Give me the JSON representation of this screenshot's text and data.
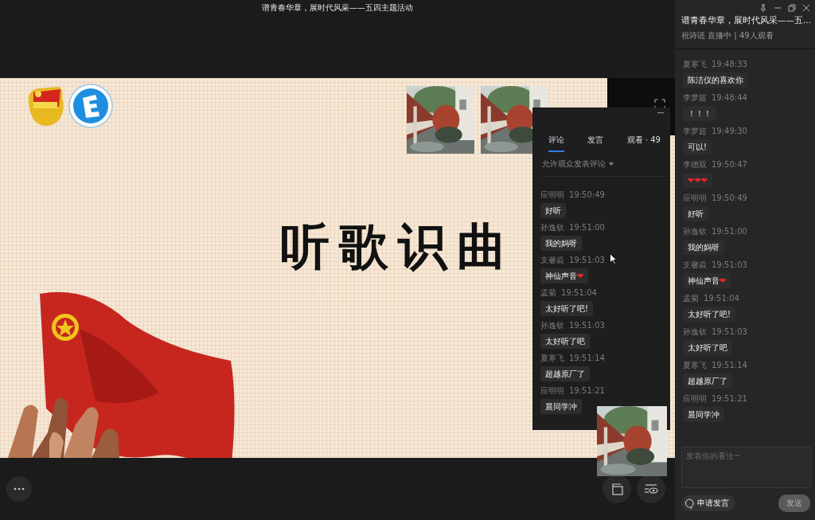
{
  "stage": {
    "title": "谱青春华章，展时代风采——五四主题活动",
    "slide": {
      "heading": "听歌识曲"
    }
  },
  "overlay_panel": {
    "tabs": [
      {
        "label": "评论",
        "selected": true
      },
      {
        "label": "发言",
        "selected": false
      },
      {
        "label": "观看 · 49",
        "selected": false
      }
    ],
    "filter": "允许观众发表评论",
    "comments": [
      {
        "name": "应明明",
        "time": "19:50:49",
        "text": "好听"
      },
      {
        "name": "孙逸钦",
        "time": "19:51:00",
        "text": "我的妈呀"
      },
      {
        "name": "支馨焱",
        "time": "19:51:03",
        "text": "神仙声音",
        "emoji": "❤"
      },
      {
        "name": "孟菊",
        "time": "19:51:04",
        "text": "太好听了吧!"
      },
      {
        "name": "孙逸钦",
        "time": "19:51:03",
        "text": "太好听了吧"
      },
      {
        "name": "夏寒飞",
        "time": "19:51:14",
        "text": "超越原厂了"
      },
      {
        "name": "应明明",
        "time": "19:51:21",
        "text": "晨同学冲"
      }
    ]
  },
  "sidebar": {
    "title": "谱青春华章，展时代风采——五...",
    "subtitle": "祝诗谣 直播中 | 49人观看",
    "messages": [
      {
        "name": "夏寒飞",
        "time": "19:48:33",
        "text": "陈洁仪的喜欢你"
      },
      {
        "name": "李梦莛",
        "time": "19:48:44",
        "text": "！！！"
      },
      {
        "name": "李梦莛",
        "time": "19:49:30",
        "text": "可以!"
      },
      {
        "name": "李德双",
        "time": "19:50:47",
        "emoji": "❤❤❤"
      },
      {
        "name": "应明明",
        "time": "19:50:49",
        "text": "好听"
      },
      {
        "name": "孙逸钦",
        "time": "19:51:00",
        "text": "我的妈呀"
      },
      {
        "name": "支馨焱",
        "time": "19:51:03",
        "text": "神仙声音",
        "emoji": "❤"
      },
      {
        "name": "孟菊",
        "time": "19:51:04",
        "text": "太好听了吧!"
      },
      {
        "name": "孙逸钦",
        "time": "19:51:03",
        "text": "太好听了吧"
      },
      {
        "name": "夏寒飞",
        "time": "19:51:14",
        "text": "超越原厂了"
      },
      {
        "name": "应明明",
        "time": "19:51:21",
        "text": "晨同学冲"
      }
    ],
    "input": {
      "placeholder": "发表你的看法~"
    },
    "buttons": [
      {
        "kind": "apply",
        "label": "申请发言"
      },
      {
        "kind": "send",
        "label": "发送",
        "disabled": true
      }
    ]
  }
}
